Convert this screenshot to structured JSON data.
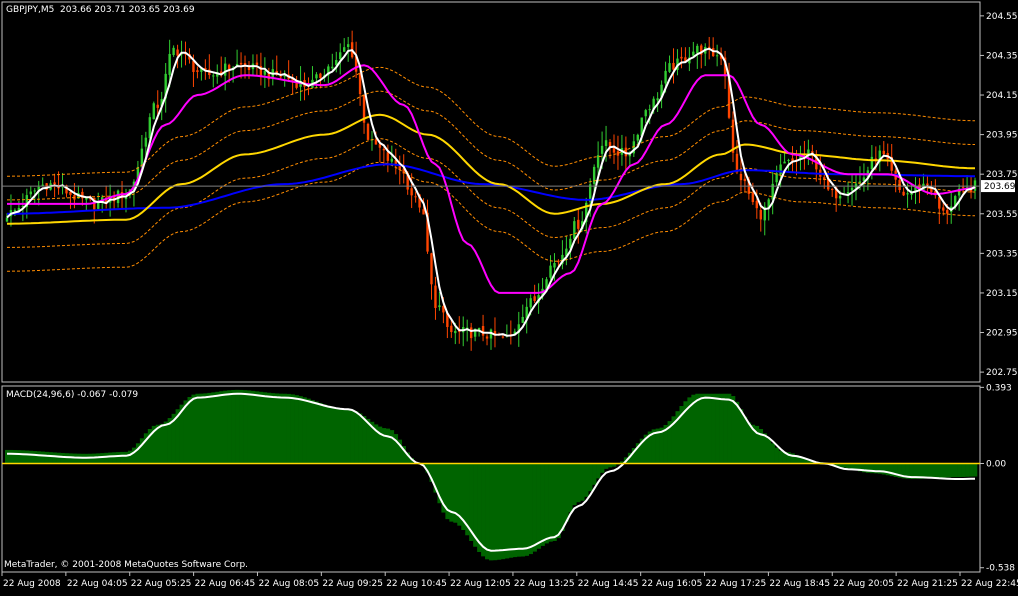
{
  "header": {
    "symbol": "GBPJPY,M5",
    "ohlc": "203.66 203.71 203.65 203.69"
  },
  "macd_header": {
    "label": "MACD(24,96,6)",
    "values": "-0.067 -0.079"
  },
  "copyright": "MetaTrader, © 2001-2008 MetaQuotes Software Corp.",
  "colors": {
    "background": "#000000",
    "frame": "#c0c0c0",
    "bull_candle": "#32cd32",
    "bear_candle": "#ff4500",
    "white_ma": "#ffffff",
    "magenta_ma": "#ff00ff",
    "gold_ma": "#ffd700",
    "blue_ma": "#0000ff",
    "envelope": "#ff8c00",
    "macd_hist": "#006400",
    "macd_signal": "#ffffff",
    "zero_line": "#ffd700"
  },
  "chart_data": [
    {
      "type": "candlestick",
      "panel": "price",
      "ylim": [
        202.7,
        204.62
      ],
      "y_ticks": [
        "204.55",
        "204.35",
        "204.15",
        "203.95",
        "203.75",
        "203.55",
        "203.35",
        "203.15",
        "202.95",
        "202.75"
      ],
      "current_price": "203.69",
      "x_ticks": [
        "22 Aug 2008",
        "22 Aug 04:05",
        "22 Aug 05:25",
        "22 Aug 06:45",
        "22 Aug 08:05",
        "22 Aug 09:25",
        "22 Aug 10:45",
        "22 Aug 12:05",
        "22 Aug 13:25",
        "22 Aug 14:45",
        "22 Aug 16:05",
        "22 Aug 17:25",
        "22 Aug 18:45",
        "22 Aug 20:05",
        "22 Aug 21:25",
        "22 Aug 22:45"
      ],
      "close_anchors": [
        [
          0,
          203.55
        ],
        [
          10,
          203.7
        ],
        [
          22,
          203.6
        ],
        [
          30,
          203.65
        ],
        [
          38,
          204.1
        ],
        [
          42,
          204.38
        ],
        [
          50,
          204.25
        ],
        [
          58,
          204.3
        ],
        [
          68,
          204.25
        ],
        [
          76,
          204.2
        ],
        [
          82,
          204.3
        ],
        [
          86,
          204.4
        ],
        [
          92,
          203.9
        ],
        [
          98,
          203.8
        ],
        [
          104,
          203.6
        ],
        [
          108,
          203.1
        ],
        [
          112,
          202.95
        ],
        [
          118,
          202.95
        ],
        [
          126,
          202.92
        ],
        [
          132,
          203.1
        ],
        [
          138,
          203.3
        ],
        [
          144,
          203.5
        ],
        [
          150,
          203.9
        ],
        [
          156,
          203.85
        ],
        [
          162,
          204.1
        ],
        [
          168,
          204.3
        ],
        [
          174,
          204.38
        ],
        [
          180,
          204.35
        ],
        [
          184,
          203.75
        ],
        [
          190,
          203.55
        ],
        [
          196,
          203.8
        ],
        [
          202,
          203.85
        ],
        [
          208,
          203.65
        ],
        [
          214,
          203.7
        ],
        [
          220,
          203.85
        ],
        [
          226,
          203.65
        ],
        [
          232,
          203.7
        ],
        [
          236,
          203.55
        ],
        [
          240,
          203.65
        ],
        [
          244,
          203.69
        ]
      ],
      "magenta_anchors": [
        [
          0,
          203.6
        ],
        [
          20,
          203.6
        ],
        [
          30,
          203.65
        ],
        [
          40,
          204.0
        ],
        [
          48,
          204.15
        ],
        [
          60,
          204.25
        ],
        [
          80,
          204.2
        ],
        [
          90,
          204.3
        ],
        [
          100,
          204.1
        ],
        [
          108,
          203.8
        ],
        [
          116,
          203.4
        ],
        [
          124,
          203.15
        ],
        [
          134,
          203.15
        ],
        [
          142,
          203.25
        ],
        [
          150,
          203.6
        ],
        [
          158,
          203.8
        ],
        [
          166,
          204.0
        ],
        [
          176,
          204.25
        ],
        [
          182,
          204.25
        ],
        [
          190,
          204.0
        ],
        [
          198,
          203.85
        ],
        [
          212,
          203.75
        ],
        [
          222,
          203.75
        ],
        [
          234,
          203.65
        ],
        [
          244,
          203.68
        ]
      ],
      "gold_anchors": [
        [
          0,
          203.5
        ],
        [
          30,
          203.52
        ],
        [
          44,
          203.7
        ],
        [
          60,
          203.85
        ],
        [
          80,
          203.95
        ],
        [
          94,
          204.05
        ],
        [
          106,
          203.95
        ],
        [
          124,
          203.7
        ],
        [
          138,
          203.55
        ],
        [
          150,
          203.6
        ],
        [
          166,
          203.7
        ],
        [
          180,
          203.85
        ],
        [
          186,
          203.9
        ],
        [
          200,
          203.85
        ],
        [
          220,
          203.82
        ],
        [
          244,
          203.78
        ]
      ],
      "blue_anchors": [
        [
          0,
          203.55
        ],
        [
          40,
          203.58
        ],
        [
          70,
          203.7
        ],
        [
          96,
          203.8
        ],
        [
          120,
          203.7
        ],
        [
          146,
          203.62
        ],
        [
          170,
          203.7
        ],
        [
          186,
          203.77
        ],
        [
          210,
          203.75
        ],
        [
          244,
          203.74
        ]
      ]
    },
    {
      "type": "histogram+line",
      "panel": "macd",
      "name": "MACD(24,96,6)",
      "ylim": [
        -0.56,
        0.4
      ],
      "y_ticks": [
        "0.393",
        "0.00",
        "-0.538"
      ],
      "hist_anchors": [
        [
          0,
          0.07
        ],
        [
          20,
          0.05
        ],
        [
          30,
          0.06
        ],
        [
          38,
          0.2
        ],
        [
          48,
          0.36
        ],
        [
          58,
          0.38
        ],
        [
          70,
          0.36
        ],
        [
          86,
          0.28
        ],
        [
          96,
          0.18
        ],
        [
          104,
          0.0
        ],
        [
          112,
          -0.3
        ],
        [
          122,
          -0.5
        ],
        [
          130,
          -0.48
        ],
        [
          138,
          -0.4
        ],
        [
          144,
          -0.2
        ],
        [
          152,
          -0.02
        ],
        [
          164,
          0.18
        ],
        [
          174,
          0.36
        ],
        [
          182,
          0.36
        ],
        [
          188,
          0.2
        ],
        [
          196,
          0.06
        ],
        [
          204,
          0.01
        ],
        [
          210,
          -0.02
        ],
        [
          218,
          -0.05
        ],
        [
          228,
          -0.08
        ],
        [
          240,
          -0.07
        ],
        [
          244,
          -0.067
        ]
      ],
      "signal_anchors": [
        [
          0,
          0.05
        ],
        [
          20,
          0.03
        ],
        [
          30,
          0.04
        ],
        [
          40,
          0.2
        ],
        [
          48,
          0.34
        ],
        [
          58,
          0.36
        ],
        [
          70,
          0.34
        ],
        [
          86,
          0.28
        ],
        [
          96,
          0.14
        ],
        [
          104,
          0.0
        ],
        [
          112,
          -0.25
        ],
        [
          122,
          -0.45
        ],
        [
          130,
          -0.44
        ],
        [
          138,
          -0.38
        ],
        [
          144,
          -0.22
        ],
        [
          152,
          -0.04
        ],
        [
          164,
          0.16
        ],
        [
          176,
          0.34
        ],
        [
          182,
          0.33
        ],
        [
          190,
          0.15
        ],
        [
          198,
          0.04
        ],
        [
          206,
          0.0
        ],
        [
          212,
          -0.03
        ],
        [
          220,
          -0.04
        ],
        [
          228,
          -0.07
        ],
        [
          240,
          -0.08
        ],
        [
          244,
          -0.079
        ]
      ]
    }
  ]
}
